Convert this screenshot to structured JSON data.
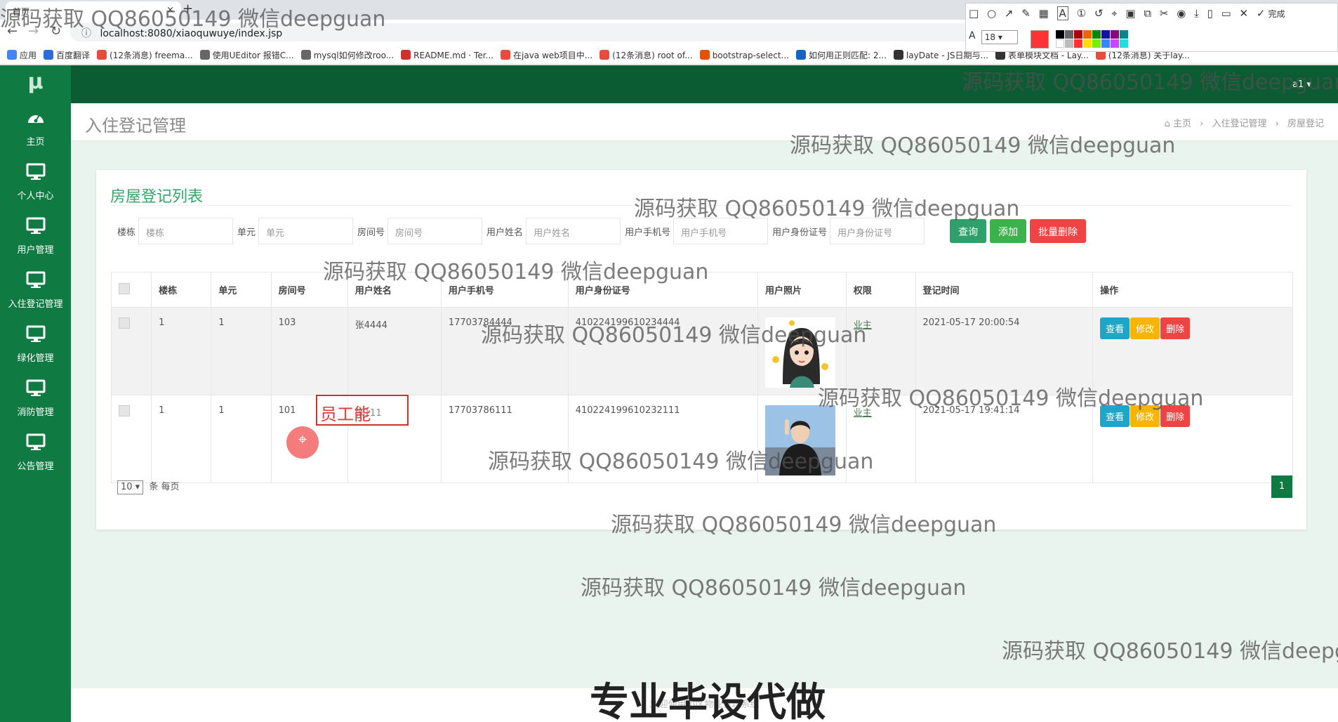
{
  "browser": {
    "tab_title": "首页",
    "url": "localhost:8080/xiaoquwuye/index.jsp",
    "bookmarks": [
      {
        "label": "应用",
        "color": "#4285f4"
      },
      {
        "label": "百度翻译",
        "color": "#2b6cd9"
      },
      {
        "label": "(12条消息) freema...",
        "color": "#e74c3c"
      },
      {
        "label": "使用UEditor 报错C...",
        "color": "#666666"
      },
      {
        "label": "mysql如何修改roo...",
        "color": "#666666"
      },
      {
        "label": "README.md · Ter...",
        "color": "#d32f2f"
      },
      {
        "label": "在java web项目中...",
        "color": "#e74c3c"
      },
      {
        "label": "(12条消息) root of...",
        "color": "#e74c3c"
      },
      {
        "label": "bootstrap-select...",
        "color": "#e65100"
      },
      {
        "label": "如何用正则匹配: 2...",
        "color": "#1565c0"
      },
      {
        "label": "layDate - JS日期与...",
        "color": "#333333"
      },
      {
        "label": "表单模块文档 - Lay...",
        "color": "#333333"
      },
      {
        "label": "(12条消息) 关于lay...",
        "color": "#e74c3c"
      }
    ]
  },
  "annotation_toolbar": {
    "done_label": "完成",
    "font_size": "18",
    "active_color": "#f33333"
  },
  "sidebar": {
    "logo": "μ",
    "items": [
      {
        "label": "主页",
        "icon": "dashboard-icon"
      },
      {
        "label": "个人中心",
        "icon": "monitor-icon"
      },
      {
        "label": "用户管理",
        "icon": "monitor-icon"
      },
      {
        "label": "入住登记管理",
        "icon": "monitor-icon"
      },
      {
        "label": "绿化管理",
        "icon": "monitor-icon"
      },
      {
        "label": "消防管理",
        "icon": "monitor-icon"
      },
      {
        "label": "公告管理",
        "icon": "monitor-icon"
      }
    ]
  },
  "topnav": {
    "user": "a1"
  },
  "page": {
    "title": "入住登记管理",
    "breadcrumb": [
      "主页",
      "入住登记管理",
      "房屋登记"
    ]
  },
  "list": {
    "title": "房屋登记列表",
    "filters": [
      {
        "label": "楼栋",
        "placeholder": "楼栋"
      },
      {
        "label": "单元",
        "placeholder": "单元"
      },
      {
        "label": "房间号",
        "placeholder": "房间号"
      },
      {
        "label": "用户姓名",
        "placeholder": "用户姓名"
      },
      {
        "label": "用户手机号",
        "placeholder": "用户手机号"
      },
      {
        "label": "用户身份证号",
        "placeholder": "用户身份证号"
      }
    ],
    "buttons": {
      "query": "查询",
      "add": "添加",
      "batch_delete": "批量删除"
    },
    "columns": [
      "楼栋",
      "单元",
      "房间号",
      "用户姓名",
      "用户手机号",
      "用户身份证号",
      "用户照片",
      "权限",
      "登记时间",
      "操作"
    ],
    "rows": [
      {
        "building": "1",
        "unit": "1",
        "room": "103",
        "name": "张4444",
        "phone": "17703784444",
        "id_no": "410224199610234444",
        "role": "业主",
        "time": "2021-05-17 20:00:54"
      },
      {
        "building": "1",
        "unit": "1",
        "room": "101",
        "name": "张111",
        "phone": "17703786111",
        "id_no": "410224199610232111",
        "role": "业主",
        "time": "2021-05-17 19:41:14"
      }
    ],
    "actions": {
      "view": "查看",
      "edit": "修改",
      "delete": "删除"
    },
    "page_size": "10",
    "page_size_suffix": "条 每页",
    "current_page": "1"
  },
  "footer": {
    "text": "欢迎使用小区物业管理系统"
  },
  "overlay": {
    "watermark": "源码获取 QQ86050149 微信deepguan",
    "banner": "专业毕设代做",
    "text_annotation": "员工能"
  }
}
